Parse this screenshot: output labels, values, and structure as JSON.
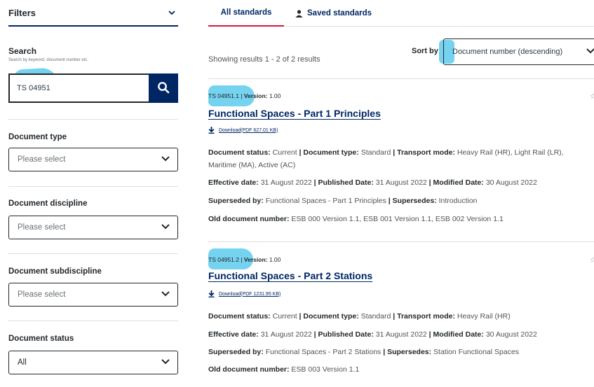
{
  "filters": {
    "label": "Filters"
  },
  "search": {
    "title": "Search",
    "hint": "Search by keyword, document number etc.",
    "value": "TS 04951"
  },
  "dropdowns": [
    {
      "label": "Document type",
      "value": "Please select"
    },
    {
      "label": "Document discipline",
      "value": "Please select"
    },
    {
      "label": "Document subdiscipline",
      "value": "Please select"
    },
    {
      "label": "Document status",
      "value": "All"
    }
  ],
  "tabs": {
    "all": "All standards",
    "saved": "Saved standards"
  },
  "results": {
    "count_text": "Showing results 1 - 2 of 2 results",
    "sort_label": "Sort by",
    "sort_value": "Document number (descending)"
  },
  "labels": {
    "version": "Version:",
    "status": "Document status:",
    "type": "Document type:",
    "transport": "Transport mode:",
    "effective": "Effective date:",
    "published": "Published Date:",
    "modified": "Modified Date:",
    "superseded_by": "Superseded by:",
    "supersedes": "Supersedes:",
    "old_number": "Old document number:",
    "sep": "|"
  },
  "documents": [
    {
      "id": "TS 04951.1",
      "version": "1.00",
      "title": "Functional Spaces - Part 1 Principles",
      "download": "Download(PDF 627.01 KB)",
      "status": "Current",
      "type": "Standard",
      "transport_mode": "Heavy Rail (HR), Light Rail (LR), Maritime (MA), Active (AC)",
      "effective_date": "31 August 2022",
      "published_date": "31 August 2022",
      "modified_date": "30 August 2022",
      "superseded_by": "Functional Spaces - Part 1 Principles",
      "supersedes": "Introduction",
      "old_number": "ESB 000 Version 1.1, ESB 001 Version 1.1, ESB 002 Version 1.1"
    },
    {
      "id": "TS 04951.2",
      "version": "1.00",
      "title": "Functional Spaces - Part 2 Stations",
      "download": "Download(PDF 1231.95 KB)",
      "status": "Current",
      "type": "Standard",
      "transport_mode": "Heavy Rail (HR)",
      "effective_date": "31 August 2022",
      "published_date": "31 August 2022",
      "modified_date": "30 August 2022",
      "superseded_by": "Functional Spaces - Part 2 Stations",
      "supersedes": "Station Functional Spaces",
      "old_number": "ESB 003 Version 1.1"
    }
  ],
  "icons": {
    "filters_toggle": "chevron-down-icon",
    "search": "search-icon",
    "select": "chevron-down-icon",
    "saved": "person-icon",
    "download": "download-icon",
    "favourite": "star-icon"
  },
  "colors": {
    "brand": "#002664",
    "accent": "#d7153a",
    "highlight": "#47c4eb"
  }
}
